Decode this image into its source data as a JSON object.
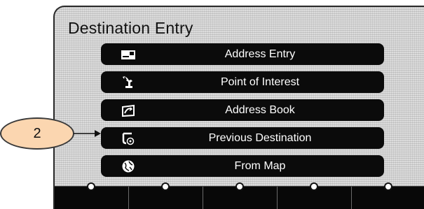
{
  "screen": {
    "title": "Destination Entry"
  },
  "menu": {
    "items": [
      {
        "label": "Address Entry",
        "icon": "card-icon"
      },
      {
        "label": "Point of Interest",
        "icon": "statue-icon"
      },
      {
        "label": "Address Book",
        "icon": "book-icon"
      },
      {
        "label": "Previous Destination",
        "icon": "history-icon"
      },
      {
        "label": "From Map",
        "icon": "globe-icon"
      }
    ]
  },
  "callout": {
    "number": "2"
  },
  "colors": {
    "button_bg": "#0b0b0b",
    "button_text": "#ffffff",
    "callout_fill": "#fbd6b0",
    "screen_bg": "#dcdcdc"
  }
}
